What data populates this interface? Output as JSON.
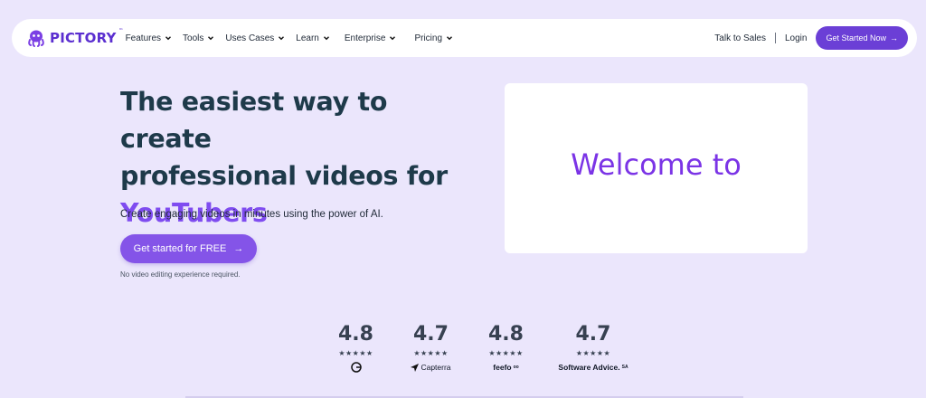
{
  "nav": {
    "logo_text": "PICTORY",
    "logo_tm": "™",
    "menu": [
      {
        "label": "Features"
      },
      {
        "label": "Tools"
      },
      {
        "label": "Uses Cases"
      },
      {
        "label": "Learn"
      },
      {
        "label": "Enterprise"
      },
      {
        "label": "Pricing"
      }
    ],
    "talk_to_sales": "Talk to Sales",
    "login": "Login",
    "get_started": "Get Started Now",
    "get_started_arrow": "→"
  },
  "hero": {
    "title_line1": "The easiest way to create",
    "title_line2": "professional videos for",
    "title_accent": "YouTubers",
    "subtitle": "Create engaging videos in minutes using the power of AI.",
    "cta_label": "Get started for FREE",
    "cta_arrow": "→",
    "note": "No video editing experience required."
  },
  "video": {
    "text": "Welcome to"
  },
  "ratings": [
    {
      "score": "4.8",
      "stars": "★★★★★",
      "brand": "G2",
      "stars_count": 5
    },
    {
      "score": "4.7",
      "stars": "★★★★★",
      "brand": "Capterra",
      "stars_count": 5
    },
    {
      "score": "4.8",
      "stars": "★★★★★",
      "brand": "feefo",
      "stars_count": 5
    },
    {
      "score": "4.7",
      "stars": "★★★★★",
      "brand": "Software Advice.",
      "stars_count": 5
    }
  ],
  "colors": {
    "background": "#ebe6fc",
    "accent": "#7f4cf0",
    "button": "#6b3fd6",
    "title": "#1e3a4a"
  }
}
